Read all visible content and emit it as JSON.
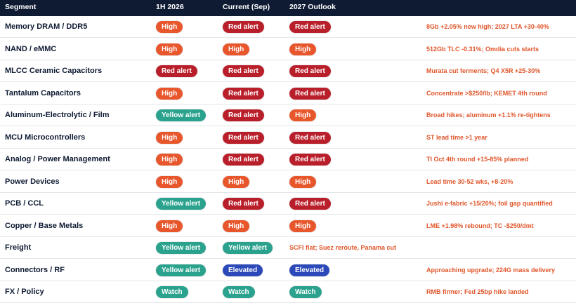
{
  "header": {
    "segment": "Segment",
    "h1_2026": "1H 2026",
    "current": "Current (Sep)",
    "outlook": "2027 Outlook"
  },
  "level_colors": {
    "High": "#e8562c",
    "Red alert": "#b91f2a",
    "Yellow alert": "#2aa28d",
    "Elevated": "#2b49b8",
    "Watch": "#2aa28d"
  },
  "note_color": "#e0562b",
  "rows": [
    {
      "segment": "Memory DRAM / DDR5",
      "h1": "High",
      "current": "Red alert",
      "outlook": "Red alert",
      "note": "8Gb +2.05% new high; 2027 LTA +30-40%"
    },
    {
      "segment": "NAND / eMMC",
      "h1": "High",
      "current": "High",
      "outlook": "High",
      "note": "512Gb TLC -0.31%; Omdia cuts starts"
    },
    {
      "segment": "MLCC Ceramic Capacitors",
      "h1": "Red alert",
      "current": "Red alert",
      "outlook": "Red alert",
      "note": "Murata cut ferments; Q4 X5R +25-30%"
    },
    {
      "segment": "Tantalum Capacitors",
      "h1": "High",
      "current": "Red alert",
      "outlook": "Red alert",
      "note": "Concentrate >$250/lb; KEMET 4th round"
    },
    {
      "segment": "Aluminum-Electrolytic / Film",
      "h1": "Yellow alert",
      "current": "Red alert",
      "outlook": "High",
      "note": "Broad hikes; aluminum +1.1% re-tightens"
    },
    {
      "segment": "MCU Microcontrollers",
      "h1": "High",
      "current": "Red alert",
      "outlook": "Red alert",
      "note": "ST lead time >1 year"
    },
    {
      "segment": "Analog / Power Management",
      "h1": "High",
      "current": "Red alert",
      "outlook": "Red alert",
      "note": "TI Oct 4th round +15-85% planned"
    },
    {
      "segment": "Power Devices",
      "h1": "High",
      "current": "High",
      "outlook": "High",
      "note": "Lead time 30-52 wks, +8-20%"
    },
    {
      "segment": "PCB / CCL",
      "h1": "Yellow alert",
      "current": "Red alert",
      "outlook": "Red alert",
      "note": "Jushi e-fabric +15/20%; foil gap quantified"
    },
    {
      "segment": "Copper / Base Metals",
      "h1": "High",
      "current": "High",
      "outlook": "High",
      "note": "LME +1.98% rebound; TC -$250/dmt"
    },
    {
      "segment": "Freight",
      "h1": "Yellow alert",
      "current": "Yellow alert",
      "outlook": "",
      "note": "SCFI flat; Suez reroute, Panama cut"
    },
    {
      "segment": "Connectors / RF",
      "h1": "Yellow alert",
      "current": "Elevated",
      "outlook": "Elevated",
      "note": "Approaching upgrade; 224G mass delivery"
    },
    {
      "segment": "FX / Policy",
      "h1": "Watch",
      "current": "Watch",
      "outlook": "Watch",
      "note": "RMB firmer; Fed 25bp hike landed"
    }
  ]
}
